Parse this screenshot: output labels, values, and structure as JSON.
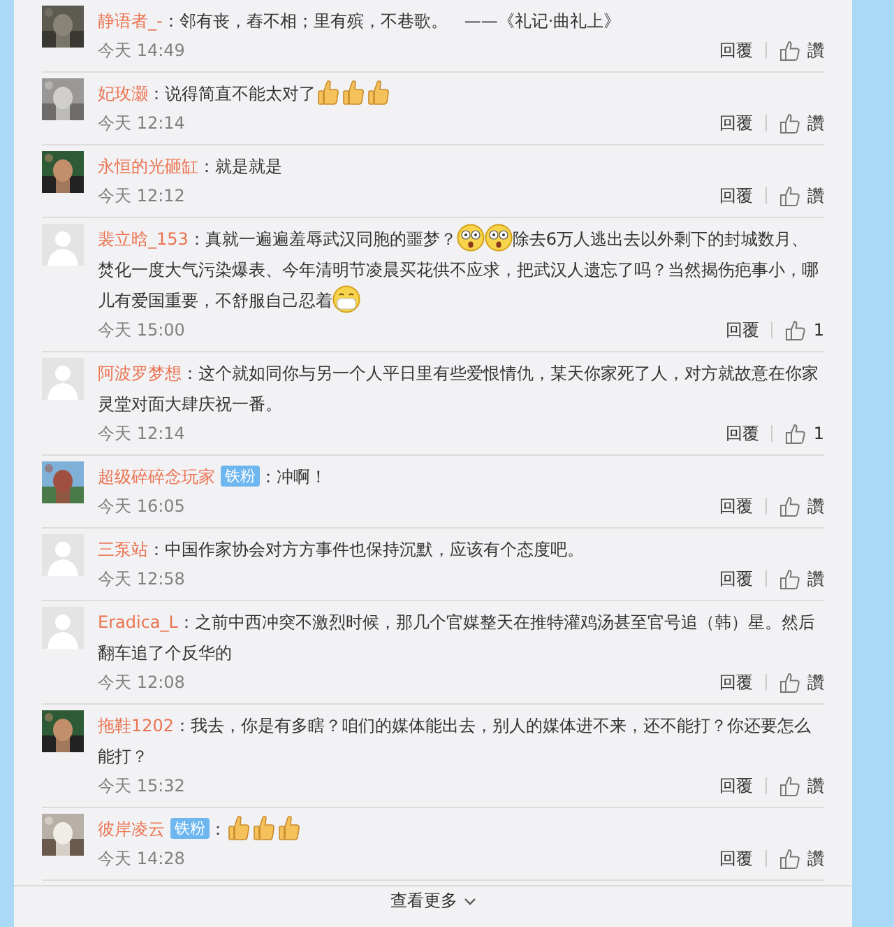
{
  "comments": [
    {
      "kind": "picture",
      "user": "静语者_-",
      "segments": [
        {
          "kind": "text",
          "text": "：邻有丧，舂不相；里有殡，不巷歌。　——《礼记·曲礼上》"
        }
      ],
      "time": "今天 14:49",
      "reply": "回覆",
      "like": "讚"
    },
    {
      "kind": "picture",
      "user": "妃玫灏",
      "segments": [
        {
          "kind": "text",
          "text": "：说得简直不能太对了"
        },
        {
          "kind": "thumbs-up"
        },
        {
          "kind": "thumbs-up"
        },
        {
          "kind": "thumbs-up"
        }
      ],
      "time": "今天 12:14",
      "reply": "回覆",
      "like": "讚"
    },
    {
      "kind": "picture",
      "user": "永恒的光砸缸",
      "segments": [
        {
          "kind": "text",
          "text": "：就是就是"
        }
      ],
      "time": "今天 12:12",
      "reply": "回覆",
      "like": "讚"
    },
    {
      "kind": "placeholder",
      "user": "裴立晗_153",
      "segments": [
        {
          "kind": "text",
          "text": "：真就一遍遍羞辱武汉同胞的噩梦？"
        },
        {
          "kind": "shocked"
        },
        {
          "kind": "shocked"
        },
        {
          "kind": "text",
          "text": "除去6万人逃出去以外剩下的封城数月、焚化一度大气污染爆表、今年清明节凌晨买花供不应求，把武汉人遗忘了吗？当然揭伤疤事小，哪儿有爱国重要，不舒服自己忍着"
        },
        {
          "kind": "mask"
        }
      ],
      "time": "今天 15:00",
      "reply": "回覆",
      "like": "1"
    },
    {
      "kind": "placeholder",
      "user": "阿波罗梦想",
      "segments": [
        {
          "kind": "text",
          "text": "：这个就如同你与另一个人平日里有些爱恨情仇，某天你家死了人，对方就故意在你家灵堂对面大肆庆祝一番。"
        }
      ],
      "time": "今天 12:14",
      "reply": "回覆",
      "like": "1"
    },
    {
      "kind": "picture",
      "user": "超级碎碎念玩家",
      "badge": "铁粉",
      "segments": [
        {
          "kind": "text",
          "text": "：冲啊！"
        }
      ],
      "time": "今天 16:05",
      "reply": "回覆",
      "like": "讚"
    },
    {
      "kind": "placeholder",
      "user": "三泵站",
      "segments": [
        {
          "kind": "text",
          "text": "：中国作家协会对方方事件也保持沉默，应该有个态度吧。"
        }
      ],
      "time": "今天 12:58",
      "reply": "回覆",
      "like": "讚"
    },
    {
      "kind": "placeholder",
      "user": "Eradica_L",
      "segments": [
        {
          "kind": "text",
          "text": "：之前中西冲突不激烈时候，那几个官媒整天在推特灌鸡汤甚至官号追（韩）星。然后翻车追了个反华的"
        }
      ],
      "time": "今天 12:08",
      "reply": "回覆",
      "like": "讚"
    },
    {
      "kind": "picture",
      "user": "拖鞋1202",
      "segments": [
        {
          "kind": "text",
          "text": "：我去，你是有多瞎？咱们的媒体能出去，别人的媒体进不来，还不能打？你还要怎么能打？"
        }
      ],
      "time": "今天 15:32",
      "reply": "回覆",
      "like": "讚"
    },
    {
      "kind": "picture",
      "user": "彼岸凌云",
      "badge": "铁粉",
      "segments": [
        {
          "kind": "text",
          "text": "："
        },
        {
          "kind": "thumbs-up"
        },
        {
          "kind": "thumbs-up"
        },
        {
          "kind": "thumbs-up"
        }
      ],
      "time": "今天 14:28",
      "reply": "回覆",
      "like": "讚"
    }
  ],
  "more": {
    "label": "查看更多"
  }
}
